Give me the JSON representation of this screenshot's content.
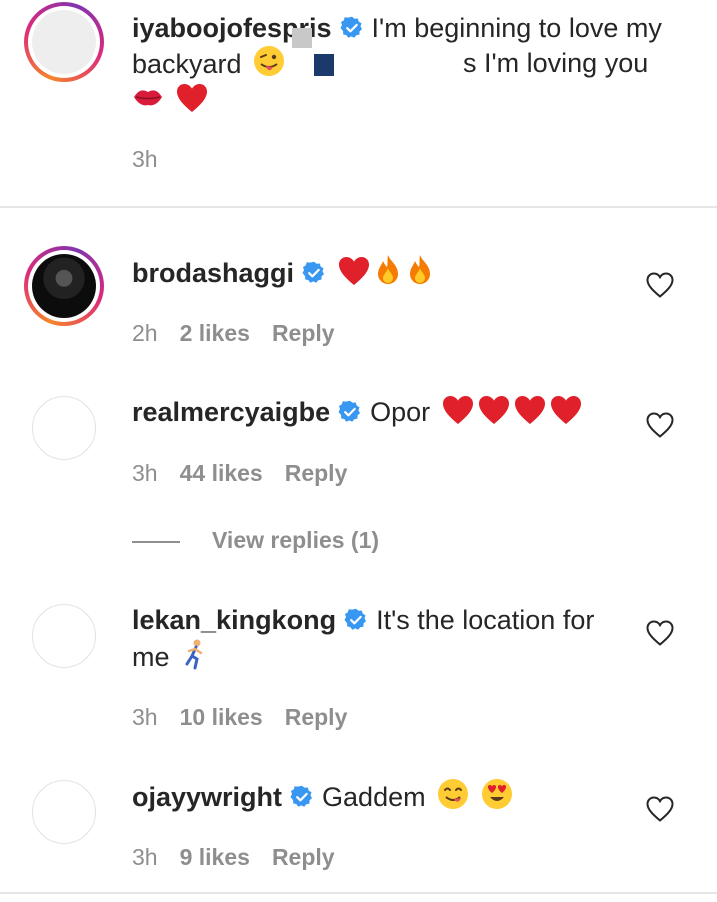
{
  "comments": [
    {
      "username": "iyaboojofespris",
      "text_line1": "I'm beginning to love my",
      "text_line2_start": "backyard",
      "text_line2_end": "s I'm loving you",
      "time": "3h",
      "emojis": [
        "winking-tongue-emoji",
        "kiss-mark-emoji",
        "red-heart-emoji"
      ]
    },
    {
      "username": "brodashaggi",
      "time": "2h",
      "likes": "2 likes",
      "reply": "Reply",
      "emojis": [
        "red-heart-emoji",
        "fire-emoji",
        "fire-emoji"
      ]
    },
    {
      "username": "realmercyaigbe",
      "text": "Opor",
      "time": "3h",
      "likes": "44 likes",
      "reply": "Reply",
      "emojis": [
        "red-heart-emoji",
        "red-heart-emoji",
        "red-heart-emoji",
        "red-heart-emoji"
      ]
    },
    {
      "username": "lekan_kingkong",
      "text_line1": "It's the location for",
      "text_line2": "me",
      "time": "3h",
      "likes": "10 likes",
      "reply": "Reply",
      "emojis": [
        "running-person-emoji"
      ]
    },
    {
      "username": "ojayywright",
      "text": "Gaddem",
      "time": "3h",
      "likes": "9 likes",
      "reply": "Reply",
      "emojis": [
        "yum-face-emoji",
        "heart-eyes-emoji"
      ]
    }
  ],
  "view_replies": "View replies (1)",
  "colors": {
    "verified": "#3897f0",
    "muted": "#8e8e8e",
    "text": "#262626",
    "heart": "#e0202b"
  }
}
